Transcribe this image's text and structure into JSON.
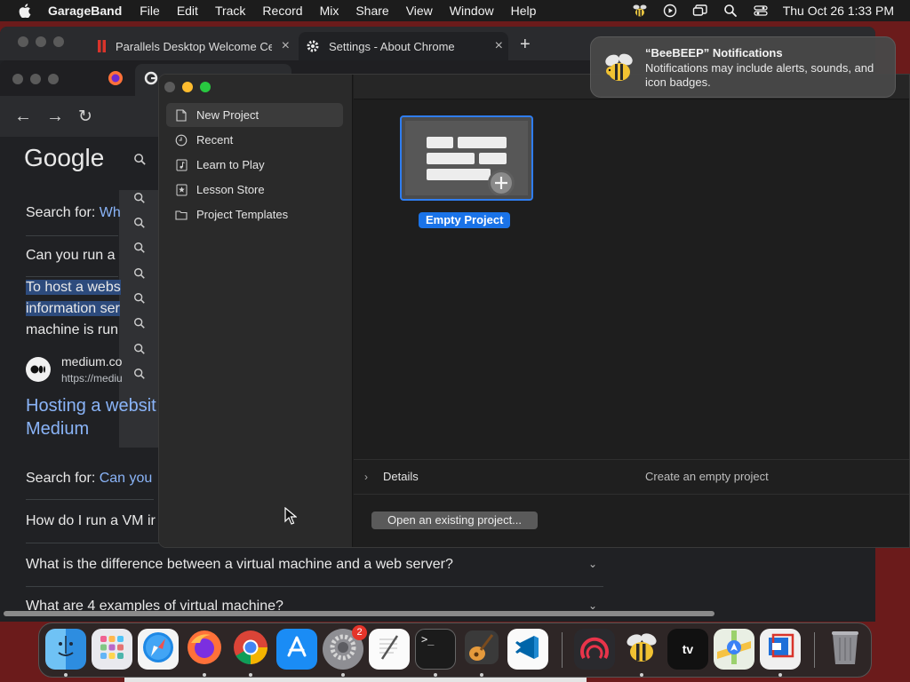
{
  "menubar": {
    "app_name": "GarageBand",
    "items": [
      "File",
      "Edit",
      "Track",
      "Record",
      "Mix",
      "Share",
      "View",
      "Window",
      "Help"
    ],
    "clock": "Thu Oct 26  1:33 PM"
  },
  "chrome_back": {
    "tabs": [
      {
        "title": "Parallels Desktop Welcome Ce"
      },
      {
        "title": "Settings - About Chrome"
      }
    ]
  },
  "chrome_front": {
    "google_logo": "Google",
    "results": {
      "search_for_prefix": "Search for:",
      "search_for_1_link": "Wh",
      "question_1": "Can you run a",
      "snippet_line1": "To host a webs",
      "snippet_line2": "information ser",
      "snippet_line3": "machine is run",
      "site_name": "medium.co",
      "site_url": "https://mediu",
      "result_title_1": "Hosting a websit",
      "result_title_2": "Medium",
      "search_for_2_link": "Can you",
      "faq_1": "How do I run a VM ir",
      "faq_2": "What is the difference between a virtual machine and a web server?",
      "faq_3": "What are 4 examples of virtual machine?"
    }
  },
  "garageband": {
    "sidebar": [
      {
        "label": "New Project",
        "icon": "document-icon",
        "active": true
      },
      {
        "label": "Recent",
        "icon": "clock-icon",
        "active": false
      },
      {
        "label": "Learn to Play",
        "icon": "music-note-icon",
        "active": false
      },
      {
        "label": "Lesson Store",
        "icon": "star-icon",
        "active": false
      },
      {
        "label": "Project Templates",
        "icon": "folder-icon",
        "active": false
      }
    ],
    "template": {
      "label": "Empty Project"
    },
    "details": {
      "label": "Details",
      "description": "Create an empty project"
    },
    "open_button": "Open an existing project..."
  },
  "notification": {
    "title": "“BeeBEEP” Notifications",
    "body": "Notifications may include alerts, sounds, and icon badges."
  },
  "dock": {
    "apps": [
      "Finder",
      "Launchpad",
      "Safari",
      "Firefox",
      "Chrome",
      "App Store",
      "System Settings",
      "TextEdit",
      "Terminal",
      "GarageBand",
      "Visual Studio Code",
      "Parallels",
      "BeeBEEP",
      "Apple TV",
      "Maps",
      "Parallels Desktop",
      "Trash"
    ],
    "settings_badge": "2"
  },
  "colors": {
    "accent_blue": "#1a73e8",
    "link_blue": "#8ab4f8",
    "close_red": "#ff5f57",
    "minimize_yellow": "#febc2e",
    "zoom_green": "#28c840"
  }
}
